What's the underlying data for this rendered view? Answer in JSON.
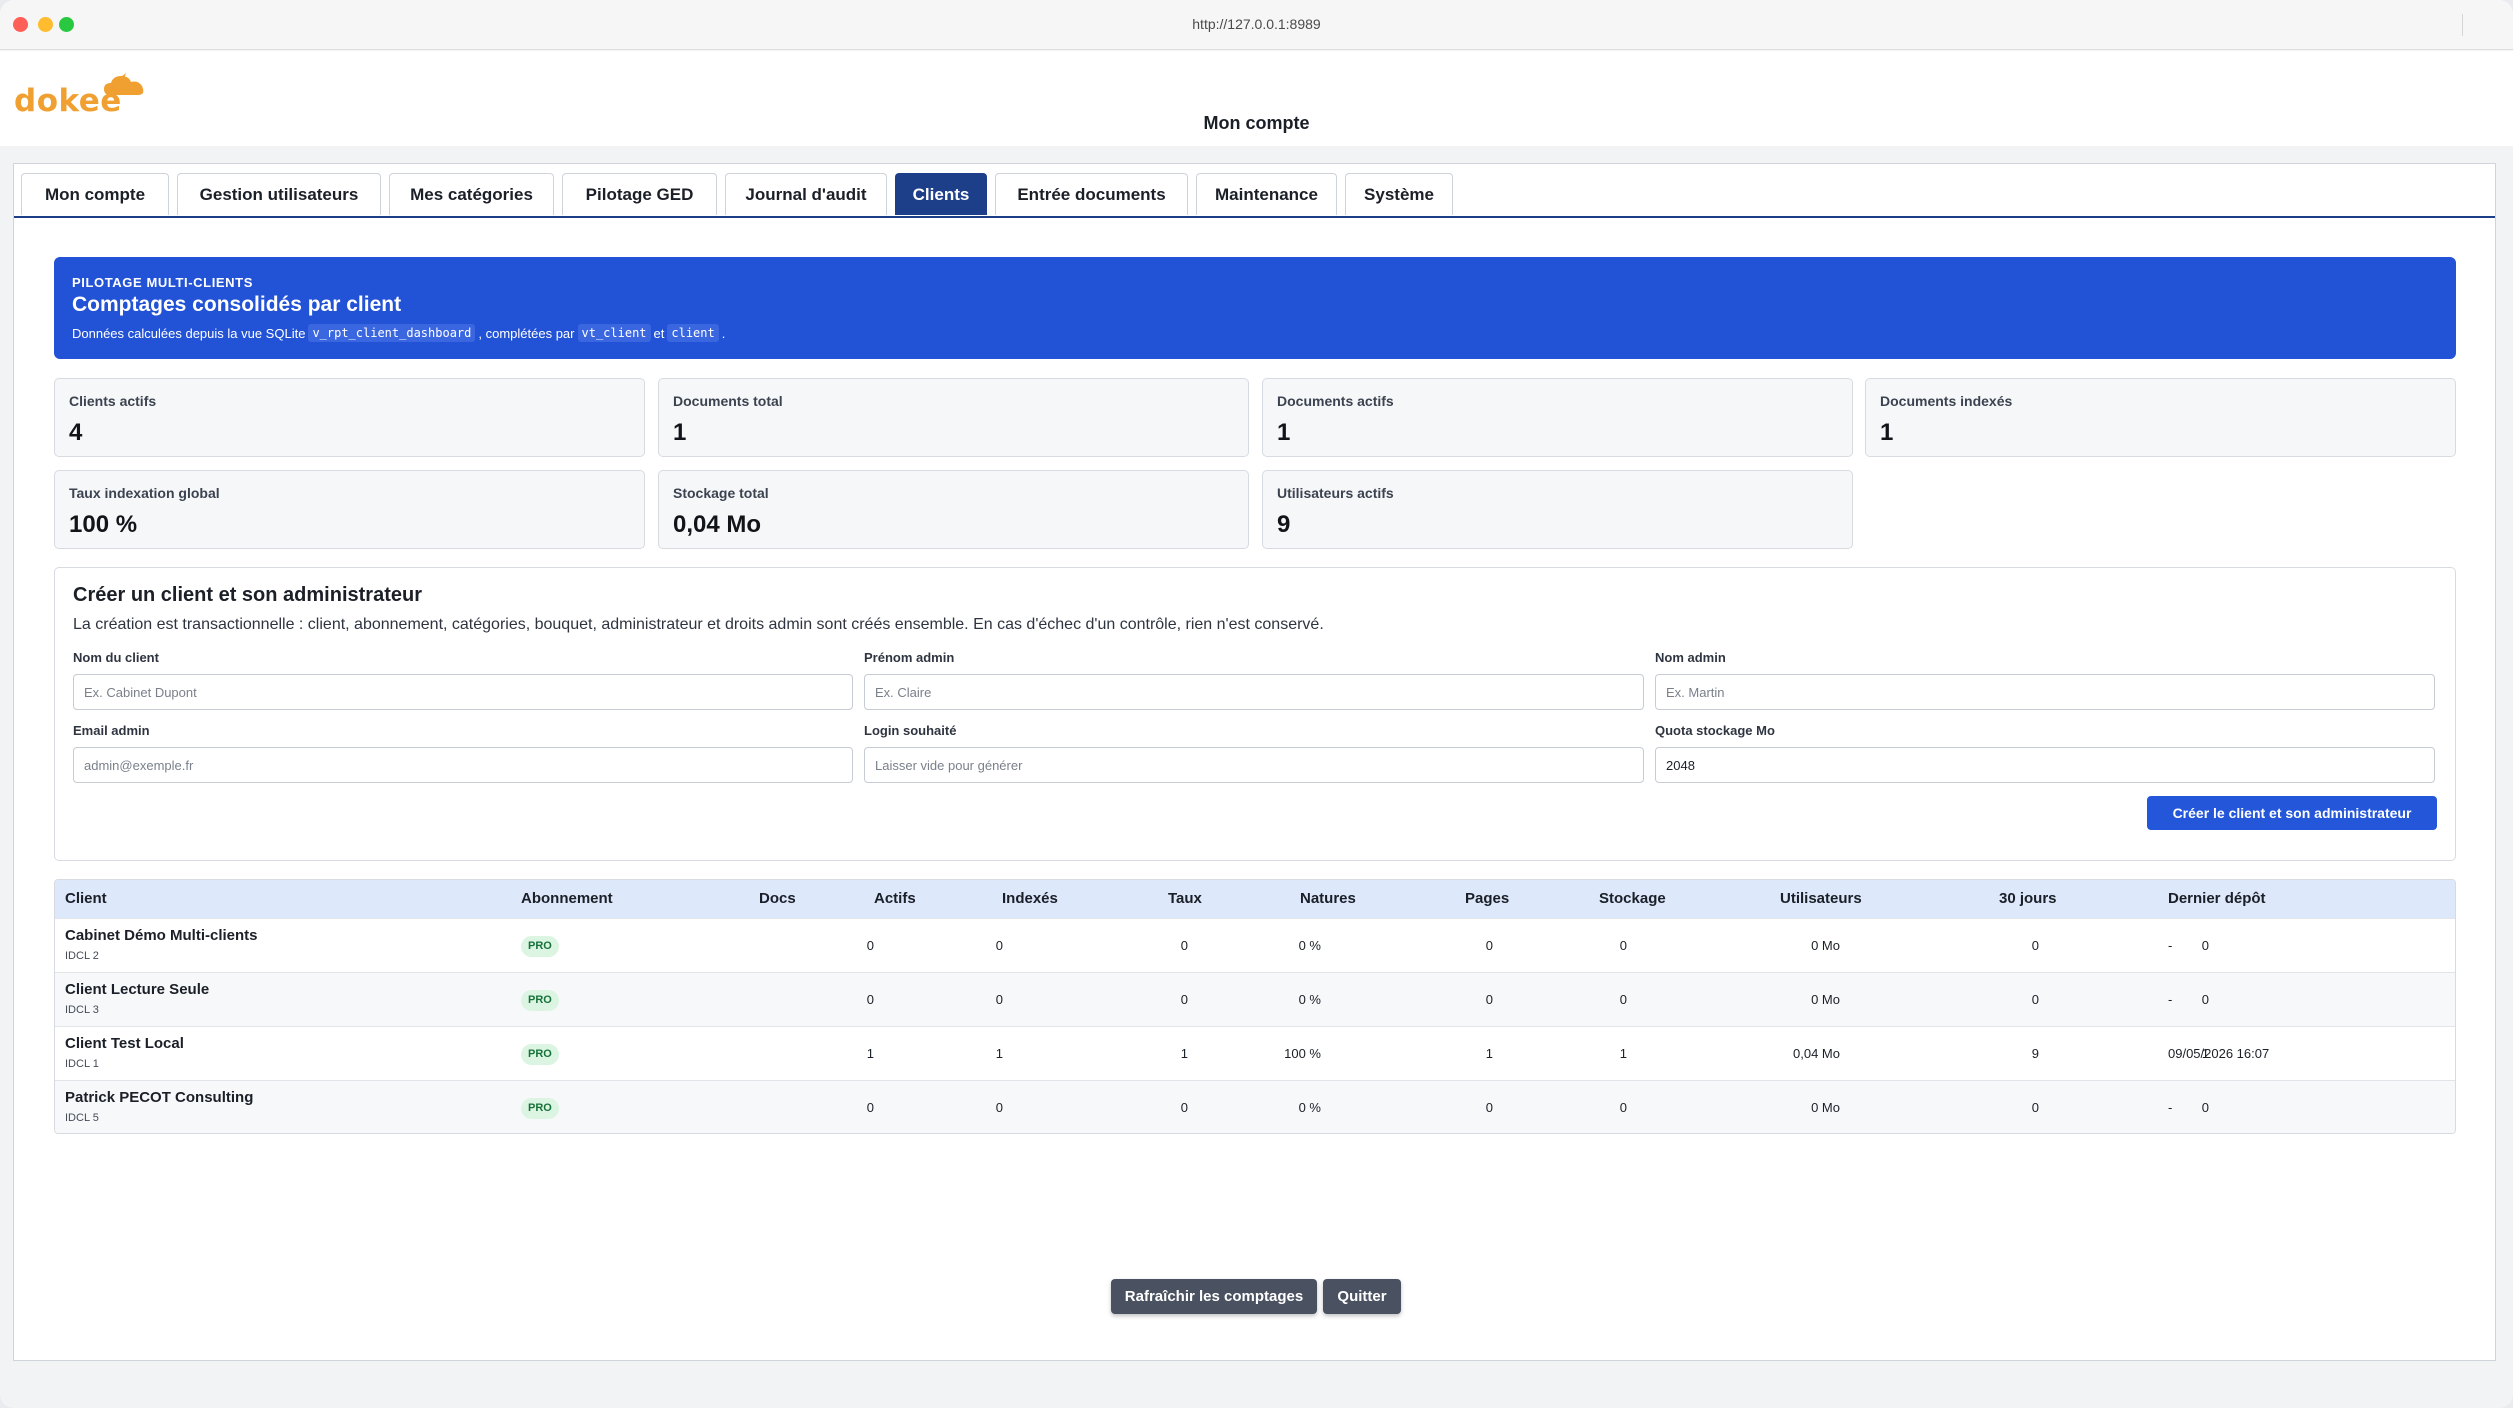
{
  "browser": {
    "url": "http://127.0.0.1:8989"
  },
  "header": {
    "logo_text": "dokee",
    "page_title": "Mon compte"
  },
  "tabs": [
    {
      "label": "Mon compte",
      "active": false
    },
    {
      "label": "Gestion utilisateurs",
      "active": false
    },
    {
      "label": "Mes catégories",
      "active": false
    },
    {
      "label": "Pilotage GED",
      "active": false
    },
    {
      "label": "Journal d'audit",
      "active": false
    },
    {
      "label": "Clients",
      "active": true
    },
    {
      "label": "Entrée documents",
      "active": false
    },
    {
      "label": "Maintenance",
      "active": false
    },
    {
      "label": "Système",
      "active": false
    }
  ],
  "banner": {
    "kicker": "PILOTAGE MULTI-CLIENTS",
    "title": "Comptages consolidés par client",
    "desc_prefix": "Données calculées depuis la vue SQLite",
    "code_view": "v_rpt_client_dashboard",
    "desc_mid": ", complétées par",
    "code_vt_client": "vt_client",
    "desc_and": "et",
    "code_client": "client",
    "desc_end": "."
  },
  "stats": [
    {
      "label": "Clients actifs",
      "value": "4"
    },
    {
      "label": "Documents total",
      "value": "1"
    },
    {
      "label": "Documents actifs",
      "value": "1"
    },
    {
      "label": "Documents indexés",
      "value": "1"
    },
    {
      "label": "Taux indexation global",
      "value": "100 %"
    },
    {
      "label": "Stockage total",
      "value": "0,04 Mo"
    },
    {
      "label": "Utilisateurs actifs",
      "value": "9"
    }
  ],
  "form": {
    "title": "Créer un client et son administrateur",
    "desc": "La création est transactionnelle : client, abonnement, catégories, bouquet, administrateur et droits admin sont créés ensemble. En cas d'échec d'un contrôle, rien n'est conservé.",
    "fields": [
      {
        "label": "Nom du client",
        "placeholder": "Ex. Cabinet Dupont",
        "value": ""
      },
      {
        "label": "Prénom admin",
        "placeholder": "Ex. Claire",
        "value": ""
      },
      {
        "label": "Nom admin",
        "placeholder": "Ex. Martin",
        "value": ""
      },
      {
        "label": "Email admin",
        "placeholder": "admin@exemple.fr",
        "value": ""
      },
      {
        "label": "Login souhaité",
        "placeholder": "Laisser vide pour générer",
        "value": ""
      },
      {
        "label": "Quota stockage Mo",
        "placeholder": "",
        "value": "2048"
      }
    ],
    "submit_label": "Créer le client et son administrateur"
  },
  "table": {
    "headers": [
      "Client",
      "Abonnement",
      "Docs",
      "Actifs",
      "Indexés",
      "Taux",
      "Natures",
      "Pages",
      "Stockage",
      "Utilisateurs",
      "30 jours",
      "Dernier dépôt"
    ],
    "rows": [
      {
        "name": "Cabinet Démo Multi-clients",
        "id": "IDCL 2",
        "plan": "PRO",
        "docs": "0",
        "actifs": "0",
        "indexes": "0",
        "taux": "0 %",
        "natures": "0",
        "pages": "0",
        "stockage": "0 Mo",
        "utilisateurs": "0",
        "jours30": "0",
        "dernier": "-"
      },
      {
        "name": "Client Lecture Seule",
        "id": "IDCL 3",
        "plan": "PRO",
        "docs": "0",
        "actifs": "0",
        "indexes": "0",
        "taux": "0 %",
        "natures": "0",
        "pages": "0",
        "stockage": "0 Mo",
        "utilisateurs": "0",
        "jours30": "0",
        "dernier": "-"
      },
      {
        "name": "Client Test Local",
        "id": "IDCL 1",
        "plan": "PRO",
        "docs": "1",
        "actifs": "1",
        "indexes": "1",
        "taux": "100 %",
        "natures": "1",
        "pages": "1",
        "stockage": "0,04 Mo",
        "utilisateurs": "9",
        "jours30": "1",
        "dernier": "09/05/2026 16:07"
      },
      {
        "name": "Patrick PECOT Consulting",
        "id": "IDCL 5",
        "plan": "PRO",
        "docs": "0",
        "actifs": "0",
        "indexes": "0",
        "taux": "0 %",
        "natures": "0",
        "pages": "0",
        "stockage": "0 Mo",
        "utilisateurs": "0",
        "jours30": "0",
        "dernier": "-"
      }
    ]
  },
  "footer": {
    "refresh_label": "Rafraîchir les comptages",
    "quit_label": "Quitter"
  },
  "colors": {
    "accent": "#2252d6",
    "tab_active": "#1d3f8a",
    "badge_bg": "#dcf5e3",
    "badge_fg": "#17723a",
    "logo": "#f0a030"
  }
}
